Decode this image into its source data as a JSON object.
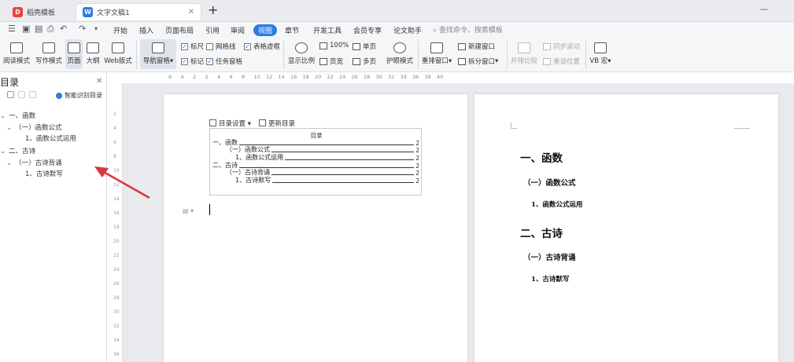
{
  "tabs": [
    {
      "label": "稻壳模板",
      "logo": "D",
      "color": "#e8423b"
    },
    {
      "label": "文字文稿1",
      "logo": "W",
      "color": "#2c7be5"
    }
  ],
  "menu": {
    "items": [
      "开始",
      "插入",
      "页面布局",
      "引用",
      "审阅",
      "视图",
      "章节",
      "开发工具",
      "会员专享",
      "论文助手"
    ],
    "active_index": 5,
    "search": "查找命令、搜索模板"
  },
  "ribbon": {
    "read_mode": "阅读模式",
    "write_mode": "写作模式",
    "page": "页面",
    "outline": "大纲",
    "web_layout": "Web版式",
    "nav_pane": "导航窗格",
    "ruler": "标尺",
    "markup": "标记",
    "grid": "网格线",
    "task_pane": "任务窗格",
    "table_gridlines": "表格虚框",
    "zoom": "显示比例",
    "hundred": "100%",
    "single_page": "单页",
    "multi_page": "多页",
    "page_width": "页宽",
    "eye_mode": "护眼模式",
    "arrange": "重排窗口",
    "new_window": "新建窗口",
    "split_window": "拆分窗口",
    "side_by_side": "并排比较",
    "sync_scroll": "同步滚动",
    "reset_pos": "重设位置",
    "vb": "VB 宏"
  },
  "sidebar": {
    "title": "目录",
    "smart_toc": "智能识别目录",
    "items": [
      {
        "label": "一、函数"
      },
      {
        "label": "（一）函数公式"
      },
      {
        "label": "1、函数公式运用"
      },
      {
        "label": "二、古诗"
      },
      {
        "label": "（一）古诗背诵"
      },
      {
        "label": "1、古诗默写"
      }
    ]
  },
  "rulers": {
    "h": [
      "6",
      "4",
      "2",
      "2",
      "4",
      "6",
      "8",
      "10",
      "12",
      "14",
      "16",
      "18",
      "20",
      "22",
      "24",
      "26",
      "28",
      "30",
      "32",
      "34",
      "36",
      "38",
      "40"
    ],
    "v": [
      "2",
      "4",
      "6",
      "8",
      "10",
      "12",
      "14",
      "16",
      "18",
      "20",
      "22",
      "24",
      "26",
      "28",
      "30",
      "32",
      "34",
      "36"
    ]
  },
  "toc_block": {
    "settings": "目录设置",
    "update": "更新目录",
    "heading": "目录",
    "lines": [
      {
        "text": "一、函数",
        "page": "2"
      },
      {
        "text": "（一）函数公式",
        "page": "2"
      },
      {
        "text": "1、函数公式运用",
        "page": "2"
      },
      {
        "text": "二、古诗",
        "page": "2"
      },
      {
        "text": "（一）古诗背诵",
        "page": "2"
      },
      {
        "text": "1、古诗默写",
        "page": "2"
      }
    ]
  },
  "page2": {
    "h1_a": "一、函数",
    "h2_a": "（一）函数公式",
    "h3_a": "1、函数公式运用",
    "h1_b": "二、古诗",
    "h2_b": "（一）古诗背诵",
    "h3_b": "1、古诗默写"
  },
  "colors": {
    "accent": "#2c7be5",
    "arrow": "#d9363e"
  }
}
